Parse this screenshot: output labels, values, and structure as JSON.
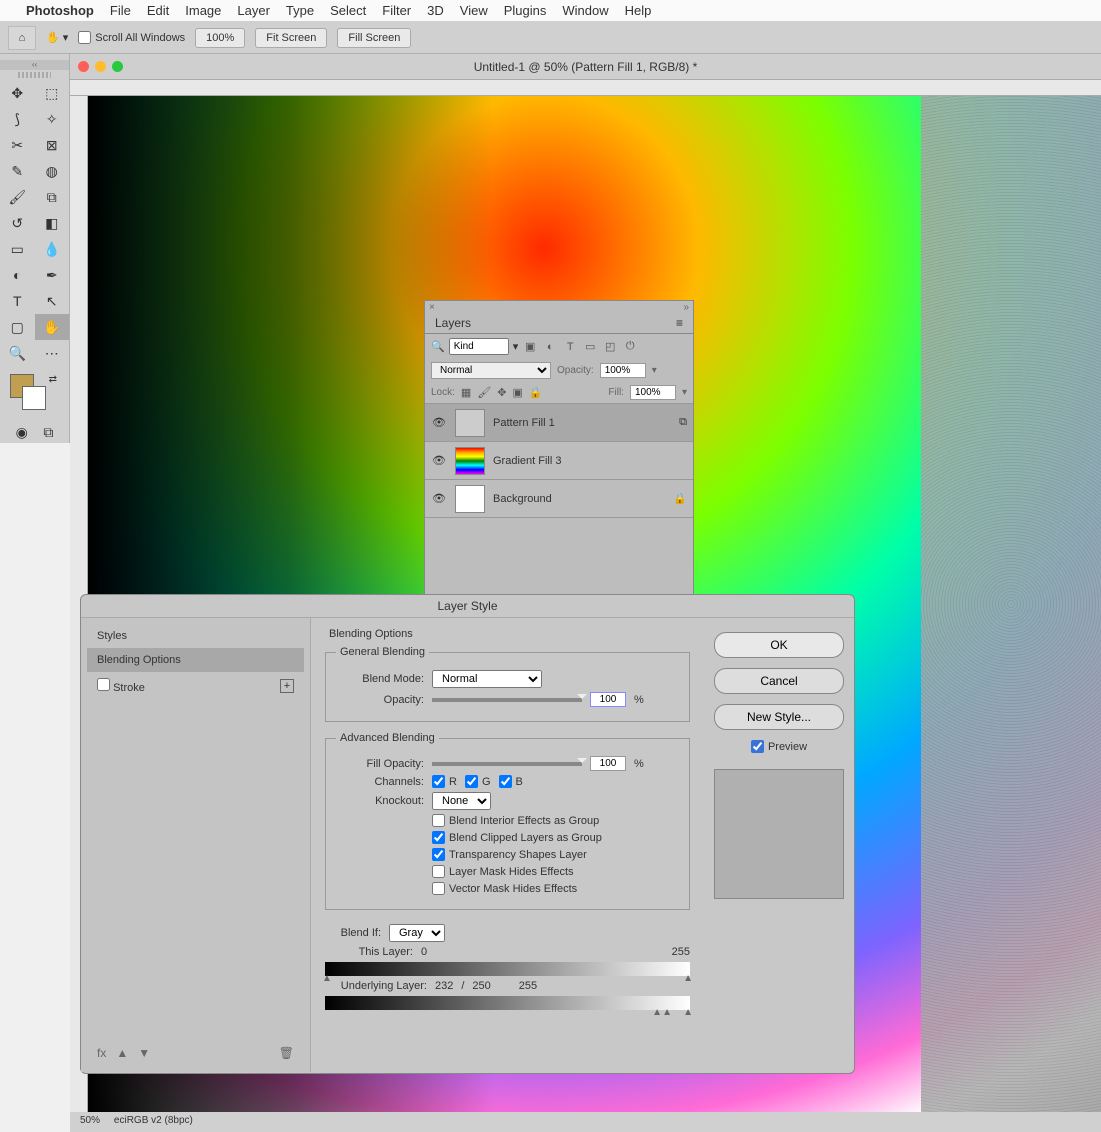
{
  "menubar": {
    "app": "Photoshop",
    "items": [
      "File",
      "Edit",
      "Image",
      "Layer",
      "Type",
      "Select",
      "Filter",
      "3D",
      "View",
      "Plugins",
      "Window",
      "Help"
    ]
  },
  "optbar": {
    "scroll_label": "Scroll All Windows",
    "zoom": "100%",
    "fit": "Fit Screen",
    "fill": "Fill Screen"
  },
  "doc": {
    "title": "Untitled-1 @ 50% (Pattern Fill 1, RGB/8) *"
  },
  "status": {
    "zoom": "50%",
    "profile": "eciRGB v2 (8bpc)"
  },
  "layers_panel": {
    "tab": "Layers",
    "kind": "Kind",
    "blend": "Normal",
    "opacity_label": "Opacity:",
    "opacity": "100%",
    "lock_label": "Lock:",
    "fill_label": "Fill:",
    "fillv": "100%",
    "items": [
      {
        "name": "Pattern Fill 1",
        "selected": true,
        "thumb": "plain"
      },
      {
        "name": "Gradient Fill 3",
        "selected": false,
        "thumb": "grad"
      },
      {
        "name": "Background",
        "selected": false,
        "thumb": "white",
        "locked": true
      }
    ]
  },
  "layerstyle": {
    "title": "Layer Style",
    "left": {
      "styles": "Styles",
      "blending": "Blending Options",
      "stroke": "Stroke"
    },
    "heading": "Blending Options",
    "general": {
      "legend": "General Blending",
      "mode_label": "Blend Mode:",
      "mode": "Normal",
      "opacity_label": "Opacity:",
      "opacity": "100",
      "pct": "%"
    },
    "advanced": {
      "legend": "Advanced Blending",
      "fill_label": "Fill Opacity:",
      "fill": "100",
      "pct": "%",
      "channels_label": "Channels:",
      "ch_r": "R",
      "ch_g": "G",
      "ch_b": "B",
      "knockout_label": "Knockout:",
      "knockout": "None",
      "cb1": "Blend Interior Effects as Group",
      "cb2": "Blend Clipped Layers as Group",
      "cb3": "Transparency Shapes Layer",
      "cb4": "Layer Mask Hides Effects",
      "cb5": "Vector Mask Hides Effects"
    },
    "blendif": {
      "label": "Blend If:",
      "value": "Gray",
      "thislayer": "This Layer:",
      "thismin": "0",
      "thismax": "255",
      "underlayer": "Underlying Layer:",
      "undermin": "232",
      "undersplit": "/",
      "undermid": "250",
      "undermax": "255"
    },
    "buttons": {
      "ok": "OK",
      "cancel": "Cancel",
      "newstyle": "New Style..."
    },
    "preview": "Preview"
  }
}
